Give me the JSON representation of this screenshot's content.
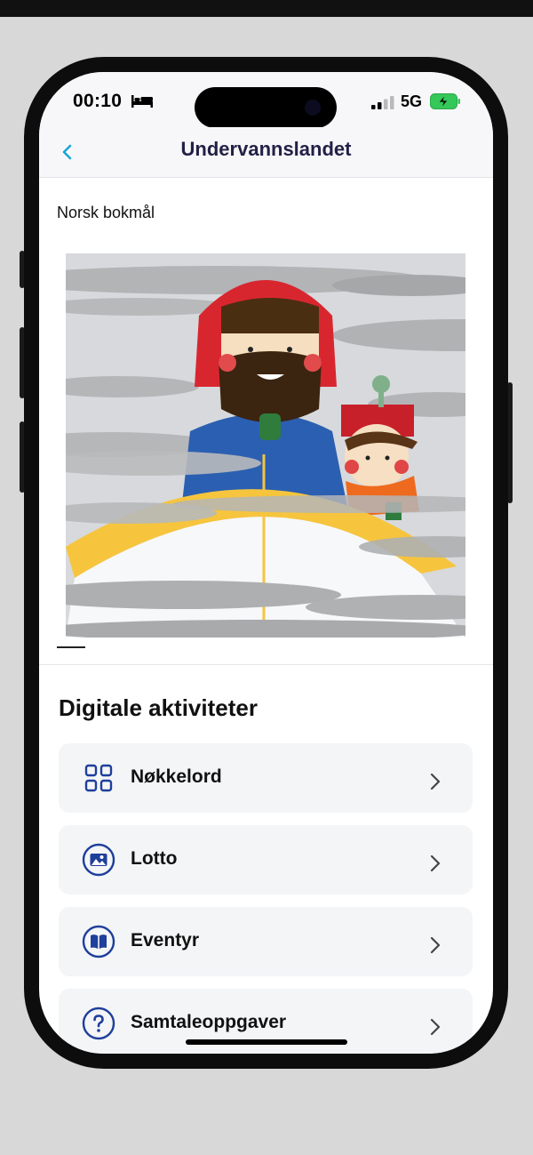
{
  "status_bar": {
    "time": "00:10",
    "network": "5G"
  },
  "nav": {
    "title": "Undervannslandet"
  },
  "story": {
    "language": "Norsk bokmål"
  },
  "activities": {
    "title": "Digitale aktiviteter",
    "items": [
      {
        "label": "Nøkkelord",
        "icon": "grid-icon"
      },
      {
        "label": "Lotto",
        "icon": "image-icon"
      },
      {
        "label": "Eventyr",
        "icon": "book-icon"
      },
      {
        "label": "Samtaleoppgaver",
        "icon": "question-icon"
      }
    ]
  },
  "colors": {
    "accent": "#1aa6d6",
    "icon_blue": "#1e3f9b",
    "title": "#232046",
    "card_bg": "#f4f5f7"
  }
}
